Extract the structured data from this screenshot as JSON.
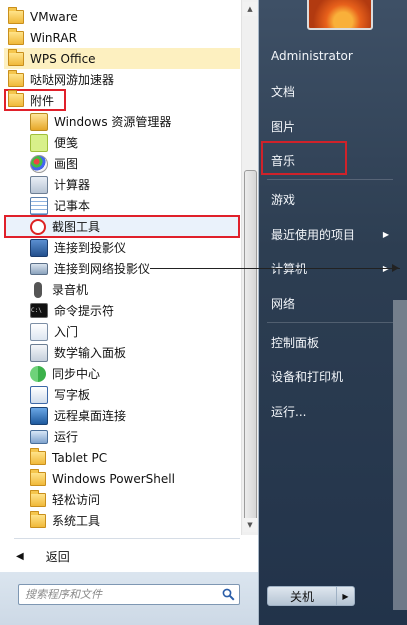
{
  "programs": [
    {
      "label": "VMware",
      "icon": "folder-icon"
    },
    {
      "label": "WinRAR",
      "icon": "folder-icon"
    },
    {
      "label": "WPS Office",
      "icon": "folder-icon"
    },
    {
      "label": "哒哒网游加速器",
      "icon": "folder-icon"
    },
    {
      "label": "附件",
      "icon": "folder-icon"
    },
    {
      "label": "Windows 资源管理器",
      "icon": "explorer-icon"
    },
    {
      "label": "便笺",
      "icon": "sticky-notes-icon"
    },
    {
      "label": "画图",
      "icon": "paint-icon"
    },
    {
      "label": "计算器",
      "icon": "calculator-icon"
    },
    {
      "label": "记事本",
      "icon": "notepad-icon"
    },
    {
      "label": "截图工具",
      "icon": "snipping-tool-icon"
    },
    {
      "label": "连接到投影仪",
      "icon": "projector-icon"
    },
    {
      "label": "连接到网络投影仪",
      "icon": "network-projector-icon"
    },
    {
      "label": "录音机",
      "icon": "microphone-icon"
    },
    {
      "label": "命令提示符",
      "icon": "command-prompt-icon"
    },
    {
      "label": "入门",
      "icon": "getting-started-icon"
    },
    {
      "label": "数学输入面板",
      "icon": "math-input-icon"
    },
    {
      "label": "同步中心",
      "icon": "sync-center-icon"
    },
    {
      "label": "写字板",
      "icon": "wordpad-icon"
    },
    {
      "label": "远程桌面连接",
      "icon": "remote-desktop-icon"
    },
    {
      "label": "运行",
      "icon": "run-icon"
    },
    {
      "label": "Tablet PC",
      "icon": "folder-icon"
    },
    {
      "label": "Windows PowerShell",
      "icon": "folder-icon"
    },
    {
      "label": "轻松访问",
      "icon": "folder-icon"
    },
    {
      "label": "系统工具",
      "icon": "folder-icon"
    }
  ],
  "back_label": "返回",
  "search": {
    "placeholder": "搜索程序和文件"
  },
  "right_menu": {
    "user": "Administrator",
    "items": [
      "文档",
      "图片",
      "音乐",
      "游戏",
      "最近使用的项目",
      "计算机",
      "网络",
      "控制面板",
      "设备和打印机",
      "运行..."
    ]
  },
  "shutdown_label": "关机",
  "colors": {
    "highlight_yellow": "#fdf0c0",
    "annotation_red": "#e0202a",
    "right_panel": "#2d3e52"
  }
}
